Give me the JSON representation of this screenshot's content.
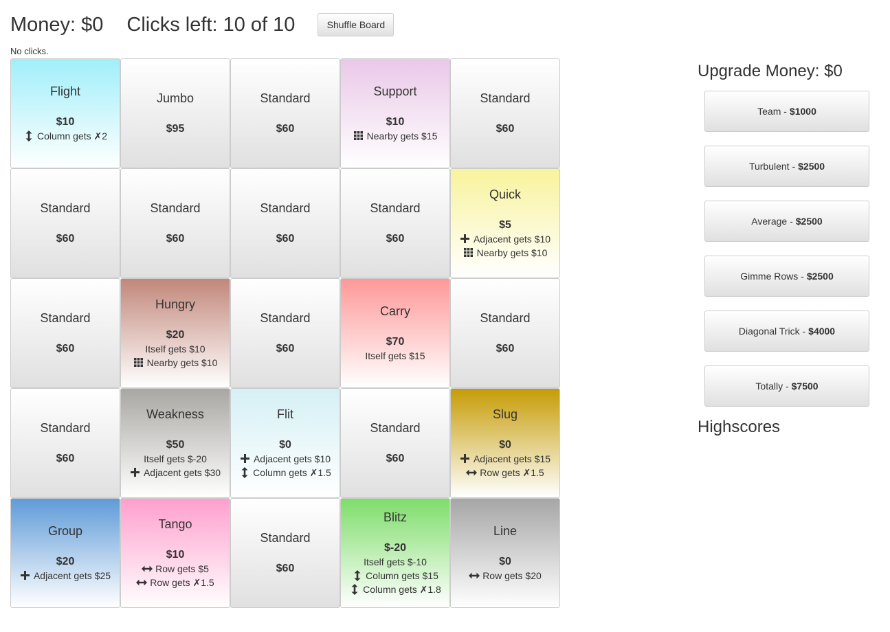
{
  "header": {
    "money": "Money: $0",
    "clicks": "Clicks left: 10 of 10",
    "shuffle_label": "Shuffle Board"
  },
  "status": "No clicks.",
  "tiles": [
    {
      "name": "Flight",
      "value": "$10",
      "bg": [
        "#a0effa",
        "#ffffff"
      ],
      "effects": [
        {
          "icon": "updown",
          "text": "Column gets ✗2"
        }
      ]
    },
    {
      "name": "Jumbo",
      "value": "$95",
      "bg": [
        "#ffffff",
        "#e0e0e0"
      ],
      "effects": []
    },
    {
      "name": "Standard",
      "value": "$60",
      "bg": [
        "#ffffff",
        "#e0e0e0"
      ],
      "effects": []
    },
    {
      "name": "Support",
      "value": "$10",
      "bg": [
        "#eac8e8",
        "#ffffff"
      ],
      "effects": [
        {
          "icon": "grid",
          "text": "Nearby gets $15"
        }
      ]
    },
    {
      "name": "Standard",
      "value": "$60",
      "bg": [
        "#ffffff",
        "#e0e0e0"
      ],
      "effects": []
    },
    {
      "name": "Standard",
      "value": "$60",
      "bg": [
        "#ffffff",
        "#e0e0e0"
      ],
      "effects": []
    },
    {
      "name": "Standard",
      "value": "$60",
      "bg": [
        "#ffffff",
        "#e0e0e0"
      ],
      "effects": []
    },
    {
      "name": "Standard",
      "value": "$60",
      "bg": [
        "#ffffff",
        "#e0e0e0"
      ],
      "effects": []
    },
    {
      "name": "Standard",
      "value": "$60",
      "bg": [
        "#ffffff",
        "#e0e0e0"
      ],
      "effects": []
    },
    {
      "name": "Quick",
      "value": "$5",
      "bg": [
        "#f8f39c",
        "#ffffff"
      ],
      "effects": [
        {
          "icon": "plus",
          "text": "Adjacent gets $10"
        },
        {
          "icon": "grid",
          "text": "Nearby gets $10"
        }
      ]
    },
    {
      "name": "Standard",
      "value": "$60",
      "bg": [
        "#ffffff",
        "#e0e0e0"
      ],
      "effects": []
    },
    {
      "name": "Hungry",
      "value": "$20",
      "bg": [
        "#c2877a",
        "#ffffff"
      ],
      "effects": [
        {
          "icon": "",
          "text": "Itself gets $10"
        },
        {
          "icon": "grid",
          "text": "Nearby gets $10"
        }
      ]
    },
    {
      "name": "Standard",
      "value": "$60",
      "bg": [
        "#ffffff",
        "#e0e0e0"
      ],
      "effects": []
    },
    {
      "name": "Carry",
      "value": "$70",
      "bg": [
        "#fe9898",
        "#ffffff"
      ],
      "effects": [
        {
          "icon": "",
          "text": "Itself gets $15"
        }
      ]
    },
    {
      "name": "Standard",
      "value": "$60",
      "bg": [
        "#ffffff",
        "#e0e0e0"
      ],
      "effects": []
    },
    {
      "name": "Standard",
      "value": "$60",
      "bg": [
        "#ffffff",
        "#e0e0e0"
      ],
      "effects": []
    },
    {
      "name": "Weakness",
      "value": "$50",
      "bg": [
        "#a8a7a3",
        "#ffffff"
      ],
      "effects": [
        {
          "icon": "",
          "text": "Itself gets $-20"
        },
        {
          "icon": "plus",
          "text": "Adjacent gets $30"
        }
      ]
    },
    {
      "name": "Flit",
      "value": "$0",
      "bg": [
        "#d5f0f5",
        "#ffffff"
      ],
      "effects": [
        {
          "icon": "plus",
          "text": "Adjacent gets $10"
        },
        {
          "icon": "updown",
          "text": "Column gets ✗1.5"
        }
      ]
    },
    {
      "name": "Standard",
      "value": "$60",
      "bg": [
        "#ffffff",
        "#e0e0e0"
      ],
      "effects": []
    },
    {
      "name": "Slug",
      "value": "$0",
      "bg": [
        "#c69c06",
        "#ffffff"
      ],
      "effects": [
        {
          "icon": "plus",
          "text": "Adjacent gets $15"
        },
        {
          "icon": "leftright",
          "text": "Row gets ✗1.5"
        }
      ]
    },
    {
      "name": "Group",
      "value": "$20",
      "bg": [
        "#5f9bd8",
        "#ffffff"
      ],
      "effects": [
        {
          "icon": "plus",
          "text": "Adjacent gets $25"
        }
      ]
    },
    {
      "name": "Tango",
      "value": "$10",
      "bg": [
        "#ff9fcd",
        "#ffffff"
      ],
      "effects": [
        {
          "icon": "leftright",
          "text": "Row gets $5"
        },
        {
          "icon": "leftright",
          "text": "Row gets ✗1.5"
        }
      ]
    },
    {
      "name": "Standard",
      "value": "$60",
      "bg": [
        "#ffffff",
        "#e0e0e0"
      ],
      "effects": []
    },
    {
      "name": "Blitz",
      "value": "$-20",
      "bg": [
        "#7edd6a",
        "#ffffff"
      ],
      "effects": [
        {
          "icon": "",
          "text": "Itself gets $-10"
        },
        {
          "icon": "updown",
          "text": "Column gets $15"
        },
        {
          "icon": "updown",
          "text": "Column gets ✗1.8"
        }
      ]
    },
    {
      "name": "Line",
      "value": "$0",
      "bg": [
        "#a6a6a6",
        "#ffffff"
      ],
      "effects": [
        {
          "icon": "leftright",
          "text": "Row gets $20"
        }
      ]
    }
  ],
  "sidebar": {
    "upgrade_title": "Upgrade Money: $0",
    "upgrades": [
      {
        "label": "Team -",
        "price": "$1000"
      },
      {
        "label": "Turbulent -",
        "price": "$2500"
      },
      {
        "label": "Average -",
        "price": "$2500"
      },
      {
        "label": "Gimme Rows -",
        "price": "$2500"
      },
      {
        "label": "Diagonal Trick -",
        "price": "$4000"
      },
      {
        "label": "Totally -",
        "price": "$7500"
      }
    ],
    "highscores_title": "Highscores"
  }
}
